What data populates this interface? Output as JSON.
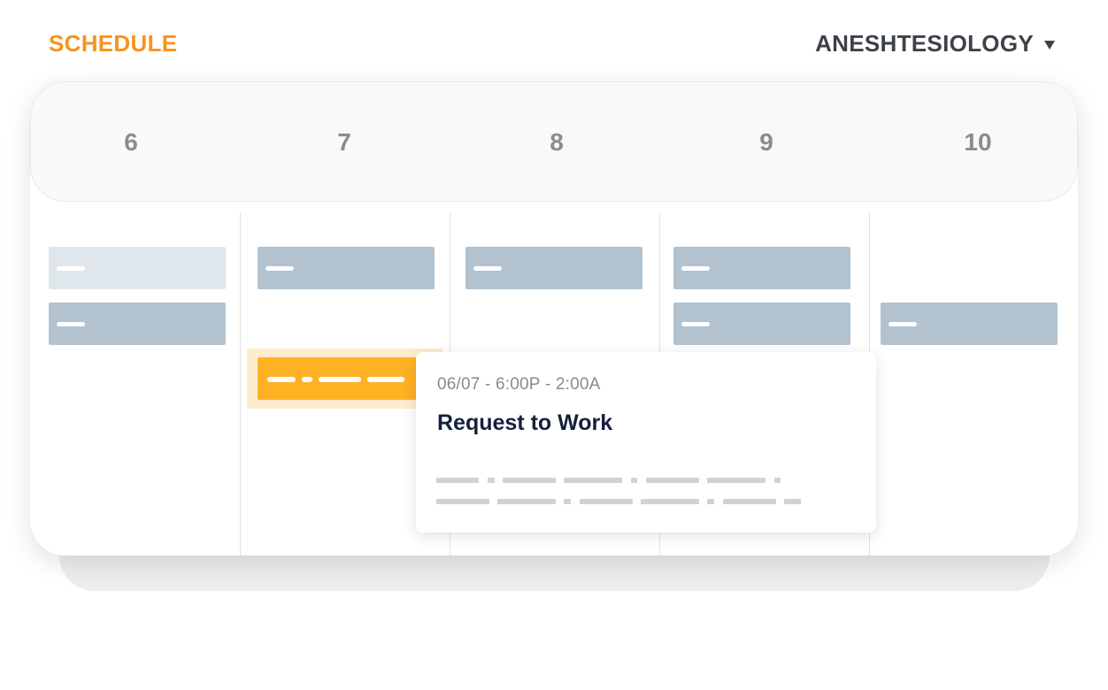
{
  "header": {
    "title": "SCHEDULE",
    "department": "ANESHTESIOLOGY"
  },
  "calendar": {
    "days": [
      "6",
      "7",
      "8",
      "9",
      "10"
    ]
  },
  "popover": {
    "time_range": "06/07 - 6:00P - 2:00A",
    "title": "Request to Work"
  },
  "colors": {
    "accent": "#f7931e",
    "shift": "#b2c3cf",
    "shift_light": "#dfe6ec",
    "shift_selected": "#ffb124",
    "selected_highlight": "#ffeccc",
    "day_number": "#8c8c8c"
  }
}
